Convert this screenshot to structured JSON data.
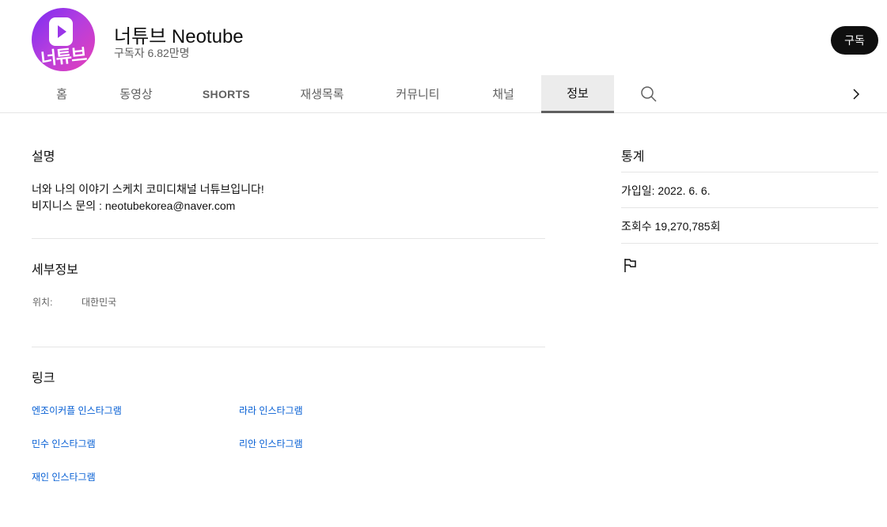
{
  "channel": {
    "logo_text": "너튜브",
    "name": "너튜브 Neotube",
    "subscribers": "구독자 6.82만명",
    "subscribe_label": "구독"
  },
  "tabs": [
    {
      "label": "홈"
    },
    {
      "label": "동영상"
    },
    {
      "label": "SHORTS"
    },
    {
      "label": "재생목록"
    },
    {
      "label": "커뮤니티"
    },
    {
      "label": "채널"
    },
    {
      "label": "정보",
      "active": true
    }
  ],
  "icons": {
    "search": "search-icon",
    "next": "chevron-right-icon",
    "report": "flag-icon"
  },
  "description": {
    "title": "설명",
    "line1": "너와 나의 이야기 스케치 코미디채널 너튜브입니다!",
    "line2": "비지니스 문의 : neotubekorea@naver.com"
  },
  "details": {
    "title": "세부정보",
    "location_label": "위치:",
    "location_value": "대한민국"
  },
  "links": {
    "title": "링크",
    "items": [
      {
        "label": "엔조이커플 인스타그램"
      },
      {
        "label": "라라 인스타그램"
      },
      {
        "label": "민수 인스타그램"
      },
      {
        "label": "리안 인스타그램"
      },
      {
        "label": "재인 인스타그램"
      }
    ]
  },
  "stats": {
    "title": "통계",
    "joined": "가입일: 2022. 6. 6.",
    "views": "조회수 19,270,785회"
  },
  "colors": {
    "link": "#065fd4",
    "secondary_text": "#606060",
    "subscribe_bg": "#0f0f0f",
    "avatar_gradient_start": "#7b2cf2",
    "avatar_gradient_end": "#e640b8"
  }
}
